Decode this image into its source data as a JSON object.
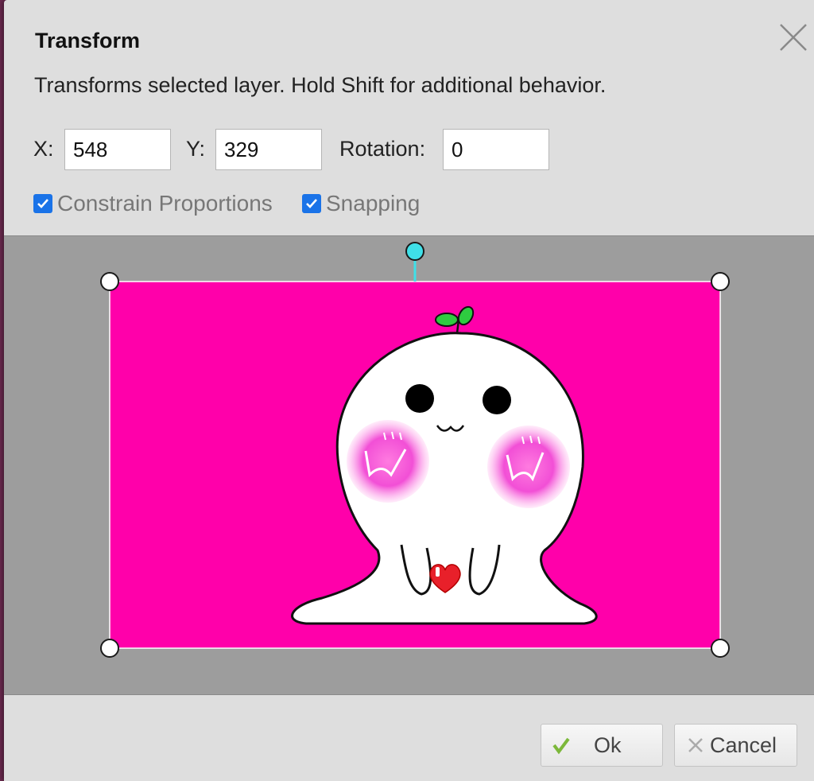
{
  "dialog": {
    "title": "Transform",
    "description": "Transforms selected layer. Hold Shift for additional behavior."
  },
  "fields": {
    "x_label": "X:",
    "x_value": "548",
    "y_label": "Y:",
    "y_value": "329",
    "rotation_label": "Rotation:",
    "rotation_value": "0"
  },
  "options": {
    "constrain_label": "Constrain Proportions",
    "constrain_checked": true,
    "snapping_label": "Snapping",
    "snapping_checked": true
  },
  "buttons": {
    "ok_label": "Ok",
    "cancel_label": "Cancel"
  },
  "icons": {
    "close": "close-icon",
    "ok": "checkmark-icon",
    "cancel": "x-icon",
    "rotate_handle": "rotate-handle",
    "resize_handle": "resize-handle"
  },
  "colors": {
    "layer_background": "#ff00aa",
    "preview_background": "#9d9d9d",
    "dialog_background": "#dedede",
    "checkbox_accent": "#1a73e8",
    "rotate_handle": "#3fe0e8",
    "ok_check": "#7cb83a"
  }
}
